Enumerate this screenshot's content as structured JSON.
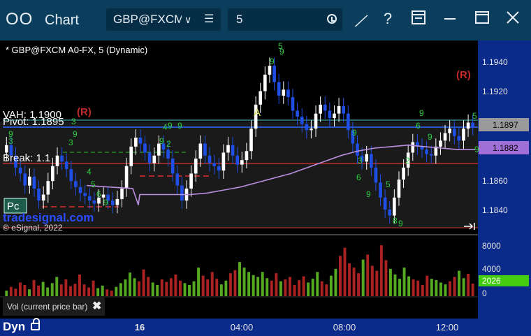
{
  "window": {
    "app_icon": "oo-logo-icon",
    "title": "Chart",
    "symbol": "GBP@FXCM",
    "interval": "5",
    "buttons": [
      "draw-tool-icon",
      "help-icon",
      "layout-icon",
      "window-icon",
      "close-icon"
    ],
    "help_label": "?"
  },
  "chart": {
    "header": "* GBP@FXCM A0-FX, 5 (Dynamic)",
    "vah_label": "VAH: 1.1900",
    "pivot_label": "Pivot: 1.1895",
    "break_label": "Break: 1.1",
    "r_marker": "(R)",
    "a_marker": "A",
    "pc_button": "Pc",
    "watermark": "tradesignal.com",
    "copyright": "© eSignal, 2022",
    "price_ticks": [
      "1.1940",
      "1.1920",
      "1.1860",
      "1.1840"
    ],
    "price_tag_main": "1.1897",
    "price_tag_avg": "1.1882",
    "volume_ticks": [
      "8000",
      "4000",
      "0"
    ],
    "volume_tag": "2026",
    "volume_label": "Vol (current price bar)",
    "time_ticks": [
      "16",
      "04:00",
      "08:00",
      "12:00"
    ],
    "dyn_label": "Dyn",
    "colors": {
      "up": "#ffffff",
      "down": "#1f4fe6",
      "avg": "#b98fe0",
      "pivot": "#2d6bff",
      "vah": "#4fd0d0",
      "break": "#e03030",
      "vol_up": "#55aa22",
      "vol_down": "#aa2222",
      "price_tag": "#9a9a9a",
      "avg_tag": "#a070d8",
      "vol_tag": "#44cc11"
    }
  },
  "chart_data": {
    "type": "candlestick",
    "ylim": [
      1.1828,
      1.1952
    ],
    "series": [
      {
        "name": "price",
        "close": [
          1.1885,
          1.1878,
          1.187,
          1.1866,
          1.1858,
          1.1864,
          1.1856,
          1.1848,
          1.1852,
          1.1861,
          1.1871,
          1.1878,
          1.1874,
          1.1869,
          1.1861,
          1.1857,
          1.1853,
          1.1851,
          1.1848,
          1.1846,
          1.185,
          1.1852,
          1.1848,
          1.1845,
          1.1849,
          1.1856,
          1.1871,
          1.1884,
          1.189,
          1.1886,
          1.188,
          1.1873,
          1.1878,
          1.1886,
          1.1882,
          1.1876,
          1.1866,
          1.1858,
          1.1848,
          1.1856,
          1.1866,
          1.1876,
          1.1886,
          1.1878,
          1.1873,
          1.1871,
          1.1868,
          1.188,
          1.1885,
          1.1878,
          1.1872,
          1.1875,
          1.1881,
          1.1896,
          1.1912,
          1.1921,
          1.1932,
          1.1938,
          1.1927,
          1.1918,
          1.1922,
          1.1917,
          1.1908,
          1.1904,
          1.1899,
          1.1895,
          1.1896,
          1.1906,
          1.1912,
          1.1908,
          1.1903,
          1.1906,
          1.1911,
          1.1906,
          1.1895,
          1.1886,
          1.1878,
          1.1874,
          1.1879,
          1.187,
          1.186,
          1.185,
          1.1842,
          1.1838,
          1.185,
          1.1862,
          1.187,
          1.188,
          1.1887,
          1.1884,
          1.1882,
          1.1879,
          1.1878,
          1.1884,
          1.1888,
          1.1893,
          1.1896,
          1.1891,
          1.1888,
          1.1896,
          1.19,
          1.1897
        ]
      },
      {
        "name": "average",
        "values": [
          1.1852,
          1.1852,
          1.1852,
          1.1852,
          1.1853,
          1.1855,
          1.1857,
          1.186,
          1.1863,
          1.1866,
          1.187,
          1.1874,
          1.1878,
          1.1881,
          1.1883,
          1.1884,
          1.1885,
          1.1884,
          1.1883,
          1.1882,
          1.1882
        ]
      },
      {
        "name": "volume",
        "values": [
          900,
          1500,
          1200,
          2200,
          1800,
          1100,
          2600,
          1700,
          2300,
          1400,
          2100,
          3100,
          1900,
          2700,
          1600,
          2000,
          3500,
          1900,
          1400,
          2500,
          1300,
          1700,
          1100,
          900,
          1500,
          2100,
          2700,
          3800,
          2900,
          2400,
          4300,
          3100,
          2200,
          1800,
          2700,
          2300,
          2900,
          3500,
          2500,
          2100,
          1800,
          2400,
          4600,
          3300,
          2700,
          3900,
          2800,
          1900,
          2500,
          3700,
          4200,
          5500,
          4600,
          3900,
          3400,
          3100,
          3900,
          2900,
          2500,
          3700,
          2400,
          2700,
          3100,
          1800,
          2600,
          3200,
          2200,
          2800,
          3900,
          2400,
          1900,
          3300,
          4400,
          6500,
          7800,
          5300,
          4600,
          3700,
          5900,
          6700,
          4900,
          4100,
          8200,
          5800,
          4400,
          3500,
          2800,
          4600,
          3200,
          2700,
          2500,
          1800,
          3300,
          2800,
          2600,
          2200,
          1900,
          2400,
          3100,
          4100,
          2900,
          3600,
          2026
        ]
      }
    ]
  }
}
